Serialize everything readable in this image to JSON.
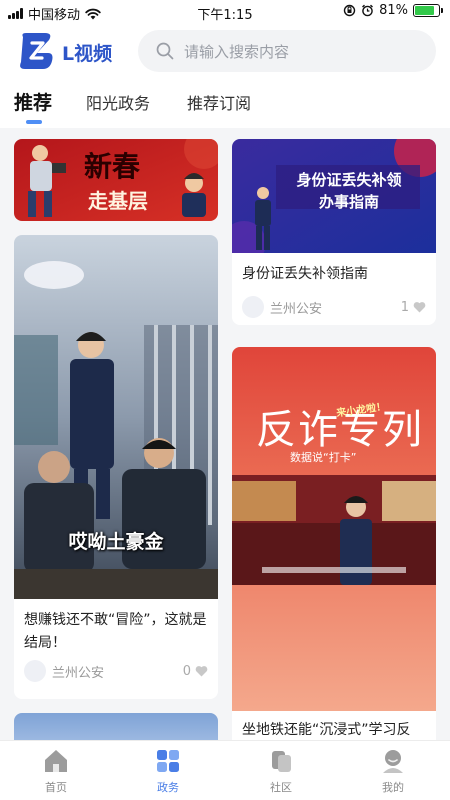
{
  "status_bar": {
    "carrier": "中国移动",
    "time": "下午1:15",
    "battery_text": "81%",
    "battery_level": 0.81
  },
  "header": {
    "app_name": "L视频",
    "search_placeholder": "请输入搜索内容"
  },
  "tabs": [
    {
      "label": "推荐",
      "active": true
    },
    {
      "label": "阳光政务",
      "active": false
    },
    {
      "label": "推荐订阅",
      "active": false
    }
  ],
  "feed": {
    "cards": [
      {
        "id": "card-new-year",
        "image_text_1": "新春",
        "image_text_2": "走基层"
      },
      {
        "id": "card-id-guide",
        "image_text_1": "身份证丢失补领",
        "image_text_2": "办事指南",
        "title": "身份证丢失补领指南",
        "author": "兰州公安",
        "likes": "1"
      },
      {
        "id": "card-money",
        "image_caption": "哎呦土豪金",
        "title": "想赚钱还不敢“冒险”，这就是结局！",
        "author": "兰州公安",
        "likes": "0"
      },
      {
        "id": "card-anti-fraud",
        "image_text_1": "反诈专列",
        "image_text_2": "来小龙啦！",
        "image_text_3": "数据说“打卡”",
        "title": "坐地铁还能“沉浸式”学习反"
      },
      {
        "id": "card-partial"
      }
    ]
  },
  "tabbar": {
    "items": [
      {
        "label": "首页",
        "icon": "home-icon",
        "active": false
      },
      {
        "label": "政务",
        "icon": "grid-icon",
        "active": true
      },
      {
        "label": "社区",
        "icon": "community-icon",
        "active": false
      },
      {
        "label": "我的",
        "icon": "profile-icon",
        "active": false
      }
    ]
  },
  "colors": {
    "accent": "#4a7ee6",
    "brand": "#2d55c8",
    "feed_bg": "#f4f5f7",
    "battery_green": "#32c94a"
  }
}
